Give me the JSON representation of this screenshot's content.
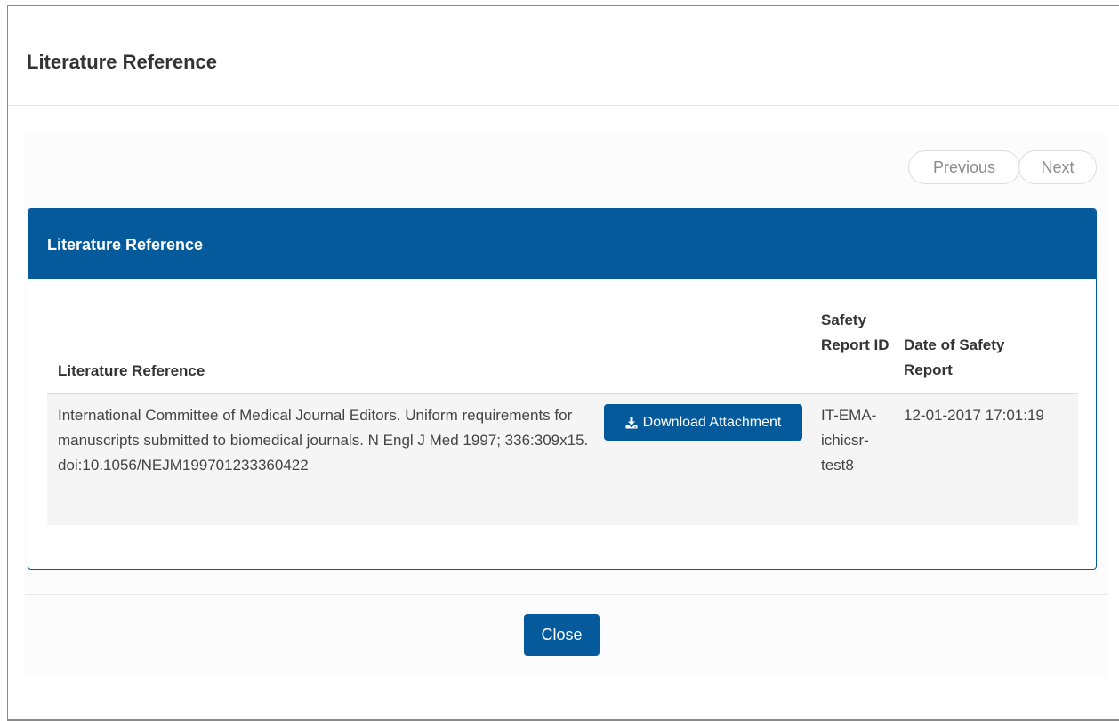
{
  "dialog": {
    "title": "Literature Reference"
  },
  "pager": {
    "previous_label": "Previous",
    "next_label": "Next"
  },
  "panel": {
    "title": "Literature Reference"
  },
  "table": {
    "headers": {
      "literature_reference": "Literature Reference",
      "safety_report_id": "Safety Report ID",
      "date_of_safety_report": "Date of Safety Report"
    },
    "rows": [
      {
        "literature_reference": "International Committee of Medical Journal Editors. Uniform requirements for manuscripts submitted to biomedical journals. N Engl J Med 1997; 336:309x15. doi:10.1056/NEJM199701233360422",
        "download_label": "Download Attachment",
        "safety_report_id": "IT-EMA-ichicsr-test8",
        "date_of_safety_report": "12-01-2017 17:01:19"
      }
    ]
  },
  "footer": {
    "close_label": "Close"
  },
  "colors": {
    "primary": "#045a9b",
    "row_background": "#f5f5f5"
  },
  "icons": {
    "download": "download-icon"
  }
}
